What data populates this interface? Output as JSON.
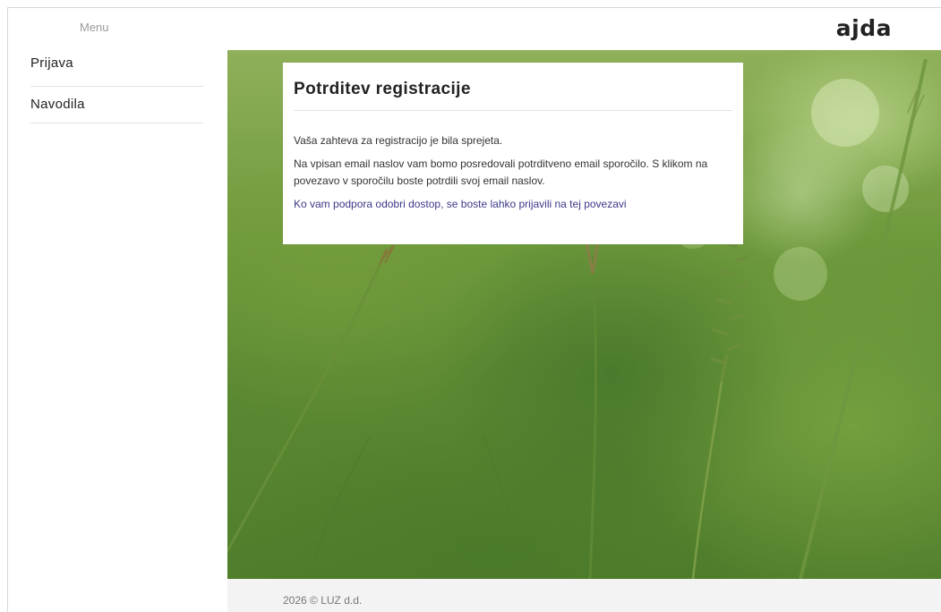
{
  "header": {
    "menu_label": "Menu",
    "logo_text": "ajda"
  },
  "sidebar": {
    "items": [
      {
        "label": "Prijava"
      },
      {
        "label": "Navodila"
      }
    ]
  },
  "card": {
    "title": "Potrditev registracije",
    "paragraph1": "Vaša zahteva za registracijo je bila sprejeta.",
    "paragraph2": "Na vpisan email naslov vam bomo posredovali potrditveno email sporočilo. S klikom na povezavo v sporočilu boste potrdili svoj email naslov.",
    "link_text": "Ko vam podpora odobri dostop, se boste lahko prijavili na tej povezavi"
  },
  "footer": {
    "copyright": "2026 © LUZ d.d."
  },
  "colors": {
    "link": "#3a3a8a",
    "footer_bg": "#f3f3f3",
    "hero_green": "#5c8a33"
  }
}
